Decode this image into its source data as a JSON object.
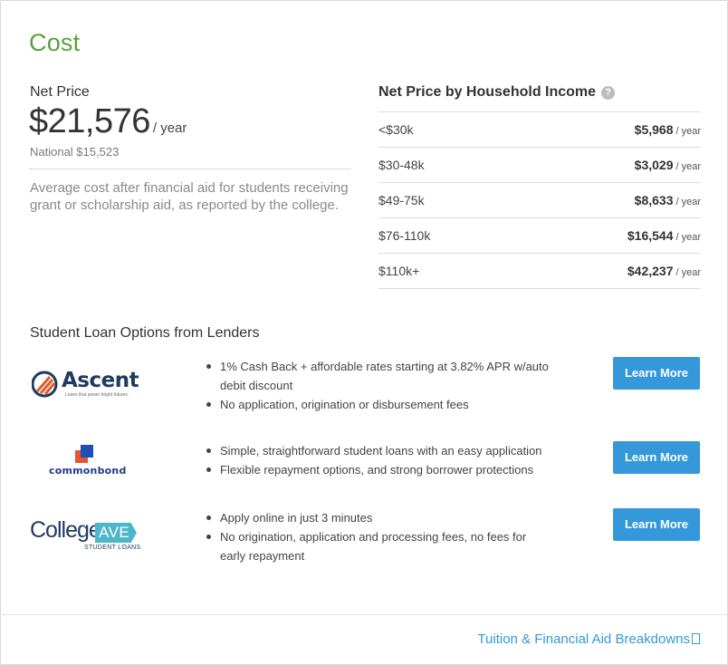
{
  "section": {
    "title": "Cost"
  },
  "net_price": {
    "label": "Net Price",
    "value": "$21,576",
    "unit": "/ year",
    "national": "National $15,523",
    "description": "Average cost after financial aid for students receiving grant or scholarship aid, as reported by the college."
  },
  "household_income": {
    "title": "Net Price by Household Income",
    "help_icon": "?",
    "per_label": "/ year",
    "rows": [
      {
        "bracket": "<$30k",
        "amount": "$5,968"
      },
      {
        "bracket": "$30-48k",
        "amount": "$3,029"
      },
      {
        "bracket": "$49-75k",
        "amount": "$8,633"
      },
      {
        "bracket": "$76-110k",
        "amount": "$16,544"
      },
      {
        "bracket": "$110k+",
        "amount": "$42,237"
      }
    ]
  },
  "loans": {
    "title": "Student Loan Options from Lenders",
    "lenders": [
      {
        "logo_text": "Ascent",
        "logo_tagline": "Loans that power bright futures.",
        "bullets": [
          "1% Cash Back + affordable rates starting at 3.82% APR w/auto debit discount",
          "No application, origination or disbursement fees"
        ],
        "button": "Learn More"
      },
      {
        "logo_text": "commonbond",
        "bullets": [
          "Simple, straightforward student loans with an easy application",
          "Flexible repayment options, and strong borrower protections"
        ],
        "button": "Learn More"
      },
      {
        "logo_text": "College",
        "logo_text2": "AVE",
        "logo_sub": "STUDENT LOANS",
        "bullets": [
          "Apply online in just 3 minutes",
          "No origination, application and processing fees, no fees for early repayment"
        ],
        "button": "Learn More"
      }
    ]
  },
  "footer": {
    "link": "Tuition & Financial Aid Breakdowns"
  },
  "colors": {
    "accent_green": "#5aa23d",
    "button_blue": "#3498db",
    "link_blue": "#3498db"
  }
}
